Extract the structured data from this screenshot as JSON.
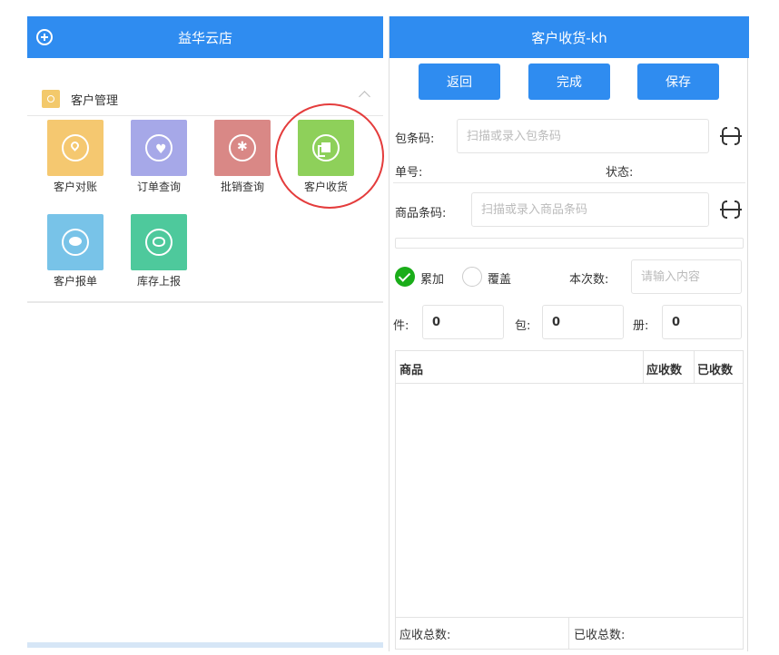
{
  "left": {
    "app_title": "益华云店",
    "section_label": "客户管理",
    "tiles": [
      {
        "label": "客户对账",
        "color": "#f5c870",
        "icon": "location-pin-icon"
      },
      {
        "label": "订单查询",
        "color": "#a6a8e8",
        "icon": "heart-icon"
      },
      {
        "label": "批销查询",
        "color": "#d98886",
        "icon": "paw-icon"
      },
      {
        "label": "客户收货",
        "color": "#8ed05a",
        "icon": "document-copy-icon"
      },
      {
        "label": "客户报单",
        "color": "#78c3e8",
        "icon": "chat-bubble-icon"
      },
      {
        "label": "库存上报",
        "color": "#4ec99c",
        "icon": "piggy-bank-icon"
      }
    ]
  },
  "right": {
    "page_title": "客户收货-kh",
    "buttons": {
      "back": "返回",
      "done": "完成",
      "save": "保存"
    },
    "package_code": {
      "label": "包条码:",
      "placeholder": "扫描或录入包条码",
      "value": ""
    },
    "order_no_label": "单号:",
    "status_label": "状态:",
    "product_code": {
      "label": "商品条码:",
      "placeholder": "扫描或录入商品条码",
      "value": ""
    },
    "mode": {
      "accumulate": "累加",
      "overwrite": "覆盖",
      "selected": "accumulate"
    },
    "this_qty": {
      "label": "本次数:",
      "placeholder": "请输入内容",
      "value": ""
    },
    "units": [
      {
        "label": "件:",
        "value": "0"
      },
      {
        "label": "包:",
        "value": "0"
      },
      {
        "label": "册:",
        "value": "0"
      }
    ],
    "table": {
      "col_product": "商品",
      "col_due": "应收数",
      "col_received": "已收数"
    },
    "footer": {
      "due_total": "应收总数:",
      "received_total": "已收总数:"
    },
    "colors": {
      "primary": "#2f8cf0",
      "check": "#1aad19",
      "highlight": "#e43c3c"
    }
  }
}
